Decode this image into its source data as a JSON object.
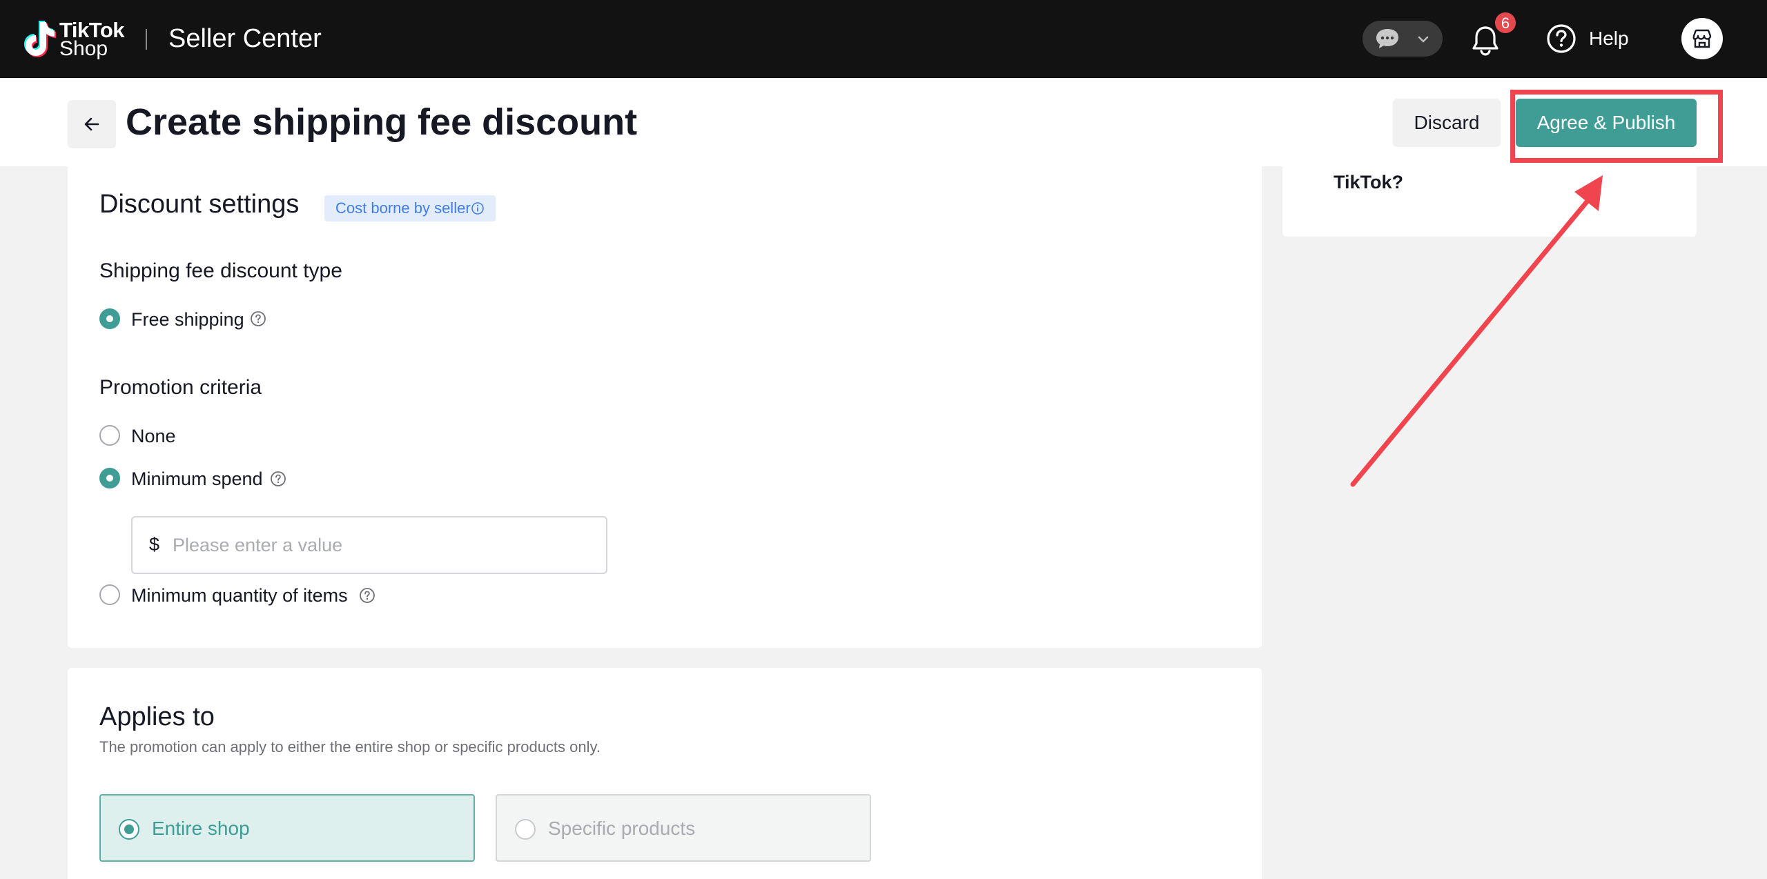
{
  "nav": {
    "brand_tiktok": "TikTok",
    "brand_shop": "Shop",
    "brand_center": "Seller Center",
    "notification_count": "6",
    "help_label": "Help"
  },
  "header": {
    "title": "Create shipping fee discount",
    "discard_label": "Discard",
    "publish_label": "Agree & Publish"
  },
  "side_panel": {
    "text": "TikTok?"
  },
  "discount_settings": {
    "title": "Discount settings",
    "cost_tag": "Cost borne by seller",
    "type_title": "Shipping fee discount type",
    "type_option": "Free shipping",
    "criteria_title": "Promotion criteria",
    "criteria_options": [
      "None",
      "Minimum spend",
      "Minimum quantity of items"
    ],
    "criteria_selected": "Minimum spend",
    "currency_prefix": "$",
    "amount_placeholder": "Please enter a value",
    "amount_value": ""
  },
  "applies_to": {
    "title": "Applies to",
    "description": "The promotion can apply to either the entire shop or specific products only.",
    "options": [
      "Entire shop",
      "Specific products"
    ],
    "selected": "Entire shop"
  },
  "colors": {
    "accent": "#3f9d96",
    "highlight": "#f0454f",
    "tag_text": "#3f7ee8",
    "tag_bg": "#e3ecfb"
  },
  "annotations": {
    "highlight_target": "publish-button",
    "arrow_target": "publish-button"
  }
}
